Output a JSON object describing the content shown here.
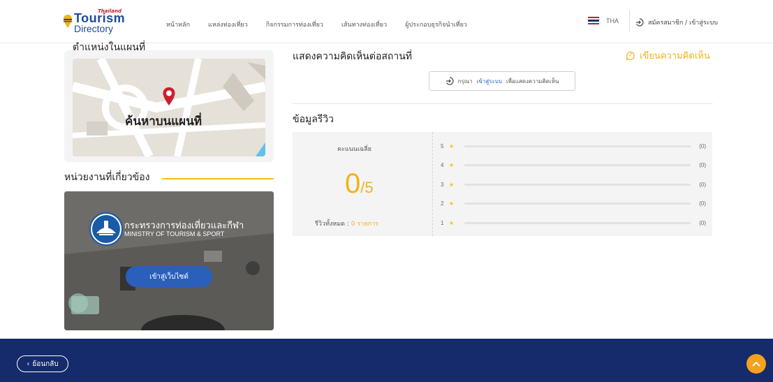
{
  "header": {
    "logo": {
      "small": "Thailand",
      "line1": "Tourism",
      "line2": "Directory"
    },
    "nav": [
      "หน้าหลัก",
      "แหล่งท่องเที่ยว",
      "กิจกรรมการท่องเที่ยว",
      "เส้นทางท่องเที่ยว",
      "ผู้ประกอบธุรกิจนำเที่ยว"
    ],
    "language": "THA",
    "login_label": "สมัครสมาชิก / เข้าสู่ระบบ"
  },
  "left": {
    "map_title": "ตำแหน่งในแผนที่",
    "map_button": "ค้นหาบนแผนที่",
    "agency_title": "หน่วยงานที่เกี่ยวข้อง",
    "agency_name_th": "กระทรวงการท่องเที่ยวและกีฬา",
    "agency_name_en": "MINISTRY OF TOURISM & SPORT",
    "visit_button": "เข้าสู่เว็บไซต์"
  },
  "comments": {
    "title": "แสดงความคิดเห็นต่อสถานที่",
    "write_label": "เขียนความคิดเห็น",
    "login_prefix": "กรุณา",
    "login_link": "เข้าสู่ระบบ",
    "login_suffix": "เพื่อแสดงความคิดเห็น"
  },
  "reviews": {
    "title": "ข้อมูลรีวิว",
    "avg_label": "คะแนนเฉลี่ย",
    "avg_value": "0",
    "avg_max": "/5",
    "total_label": "รีวิวทั้งหมด :",
    "total_value": "0 รายการ",
    "rows": [
      {
        "stars": "5",
        "count": "(0)",
        "fraction": 0
      },
      {
        "stars": "4",
        "count": "(0)",
        "fraction": 0
      },
      {
        "stars": "3",
        "count": "(0)",
        "fraction": 0
      },
      {
        "stars": "2",
        "count": "(0)",
        "fraction": 0
      },
      {
        "stars": "1",
        "count": "(0)",
        "fraction": 0
      }
    ]
  },
  "footer": {
    "back_label": "ย้อนกลับ"
  },
  "colors": {
    "accent": "#f3b21b",
    "primary": "#2b5fbc",
    "footer": "#152b6b"
  }
}
